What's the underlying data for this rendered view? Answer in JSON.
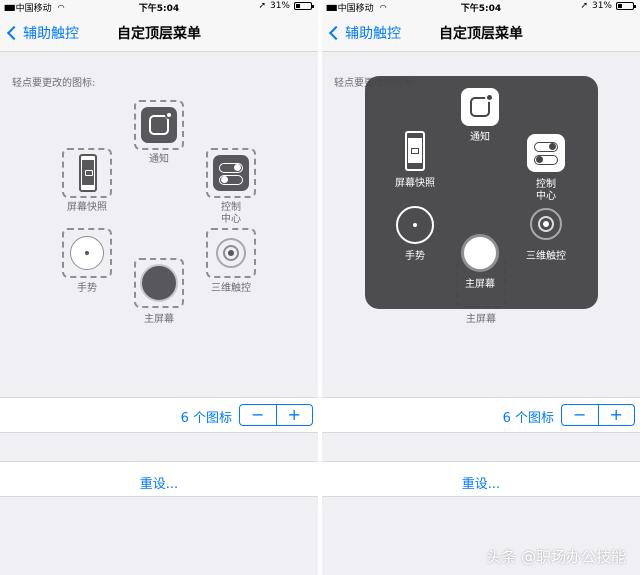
{
  "status": {
    "carrier": "中国移动",
    "time": "下午5:04",
    "battery": "31%",
    "battery_level": 0.31
  },
  "nav": {
    "back_label": "辅助触控",
    "title": "自定顶层菜单"
  },
  "section_label": "轻点要更改的图标:",
  "icons": {
    "notification": "通知",
    "screenshot": "屏幕快照",
    "control_center_line1": "控制",
    "control_center_line2": "中心",
    "gesture": "手势",
    "3d_touch": "三维触控",
    "home": "主屏幕"
  },
  "count": {
    "label": "6 个图标",
    "minus": "−",
    "plus": "+"
  },
  "reset_label": "重设...",
  "watermark": "头条 @职场办公技能",
  "colors": {
    "accent": "#007aff",
    "tile": "#58585c",
    "overlay": "#464648"
  }
}
